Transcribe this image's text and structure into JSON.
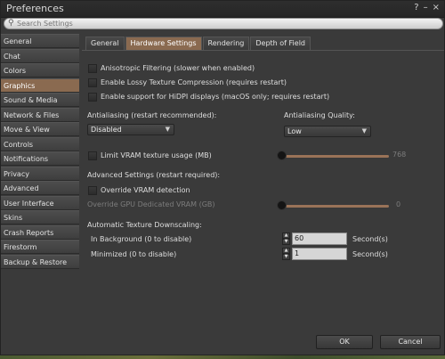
{
  "window": {
    "title": "Preferences",
    "help_glyph": "?",
    "minimize_glyph": "–",
    "close_glyph": "×"
  },
  "search": {
    "placeholder": "Search Settings",
    "icon": "search-icon",
    "icon_glyph": "⚲"
  },
  "sidebar": {
    "items": [
      {
        "label": "General"
      },
      {
        "label": "Chat"
      },
      {
        "label": "Colors"
      },
      {
        "label": "Graphics"
      },
      {
        "label": "Sound & Media"
      },
      {
        "label": "Network & Files"
      },
      {
        "label": "Move & View"
      },
      {
        "label": "Controls"
      },
      {
        "label": "Notifications"
      },
      {
        "label": "Privacy"
      },
      {
        "label": "Advanced"
      },
      {
        "label": "User Interface"
      },
      {
        "label": "Skins"
      },
      {
        "label": "Crash Reports"
      },
      {
        "label": "Firestorm"
      },
      {
        "label": "Backup & Restore"
      }
    ],
    "active": "Graphics"
  },
  "tabs": [
    {
      "label": "General"
    },
    {
      "label": "Hardware Settings"
    },
    {
      "label": "Rendering"
    },
    {
      "label": "Depth of Field"
    }
  ],
  "active_tab": "Hardware Settings",
  "hardware": {
    "anisotropic_label": "Anisotropic Filtering (slower when enabled)",
    "lossy_label": "Enable Lossy Texture Compression (requires restart)",
    "hidpi_label": "Enable support for HiDPI displays (macOS only; requires restart)",
    "antialiasing_label": "Antialiasing (restart recommended):",
    "antialiasing_value": "Disabled",
    "aa_quality_label": "Antialiasing Quality:",
    "aa_quality_value": "Low",
    "limit_vram_label": "Limit VRAM texture usage (MB)",
    "limit_vram_value": "768",
    "limit_vram_fraction": 0.0,
    "advanced_label": "Advanced Settings (restart required):",
    "override_vram_label": "Override VRAM detection",
    "override_gpu_label": "Override GPU Dedicated VRAM (GB)",
    "override_gpu_value": "0",
    "override_gpu_fraction": 0.0,
    "downscaling_label": "Automatic Texture Downscaling:",
    "background_label": "In Background (0 to disable)",
    "background_value": "60",
    "background_unit": "Second(s)",
    "minimized_label": "Minimized (0 to disable)",
    "minimized_value": "1",
    "minimized_unit": "Second(s)"
  },
  "footer": {
    "ok_label": "OK",
    "cancel_label": "Cancel"
  },
  "colors": {
    "accent": "#8a6a50",
    "slider": "#9a7358",
    "background": "#3a3a3a"
  }
}
